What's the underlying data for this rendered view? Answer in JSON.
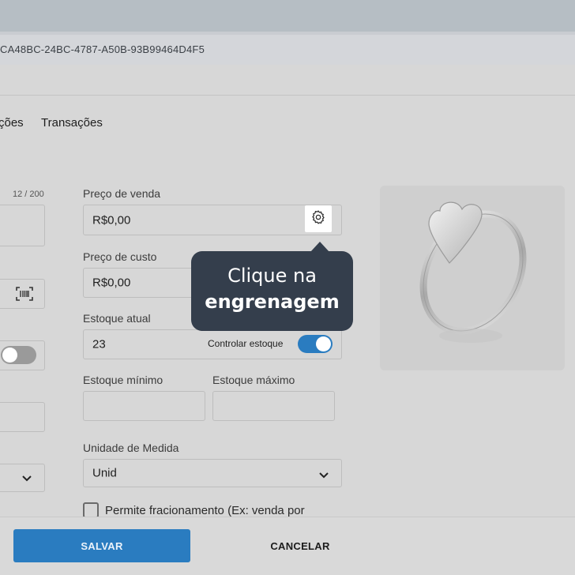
{
  "header": {
    "record_id": "CA48BC-24BC-4787-A50B-93B99464D4F5"
  },
  "tabs": [
    {
      "label": "ções"
    },
    {
      "label": "Transações"
    }
  ],
  "left_column": {
    "char_counter": "12 / 200"
  },
  "pricing": {
    "sale_price_label": "Preço de venda",
    "sale_price_value": "R$0,00",
    "cost_price_label": "Preço de custo",
    "cost_price_value": "R$0,00"
  },
  "stock": {
    "current_label": "Estoque atual",
    "current_value": "23",
    "control_label": "Controlar estoque",
    "control_enabled": true,
    "min_label": "Estoque mínimo",
    "min_value": "",
    "max_label": "Estoque máximo",
    "max_value": ""
  },
  "unit": {
    "label": "Unidade de Medida",
    "selected": "Unid"
  },
  "fraction": {
    "label": "Permite fracionamento (Ex: venda por",
    "checked": false
  },
  "tooltip": {
    "line1": "Clique na",
    "line2": "engrenagem"
  },
  "footer": {
    "save_label": "SALVAR",
    "cancel_label": "CANCELAR"
  },
  "colors": {
    "primary": "#2a7cc0",
    "tooltip_bg": "#343e4c",
    "toggle_on": "#2a7cc0",
    "toggle_off": "#9a9a9a"
  },
  "icons": [
    "gear-icon",
    "barcode-scan-icon",
    "chevron-down-icon",
    "ring-product-image"
  ]
}
